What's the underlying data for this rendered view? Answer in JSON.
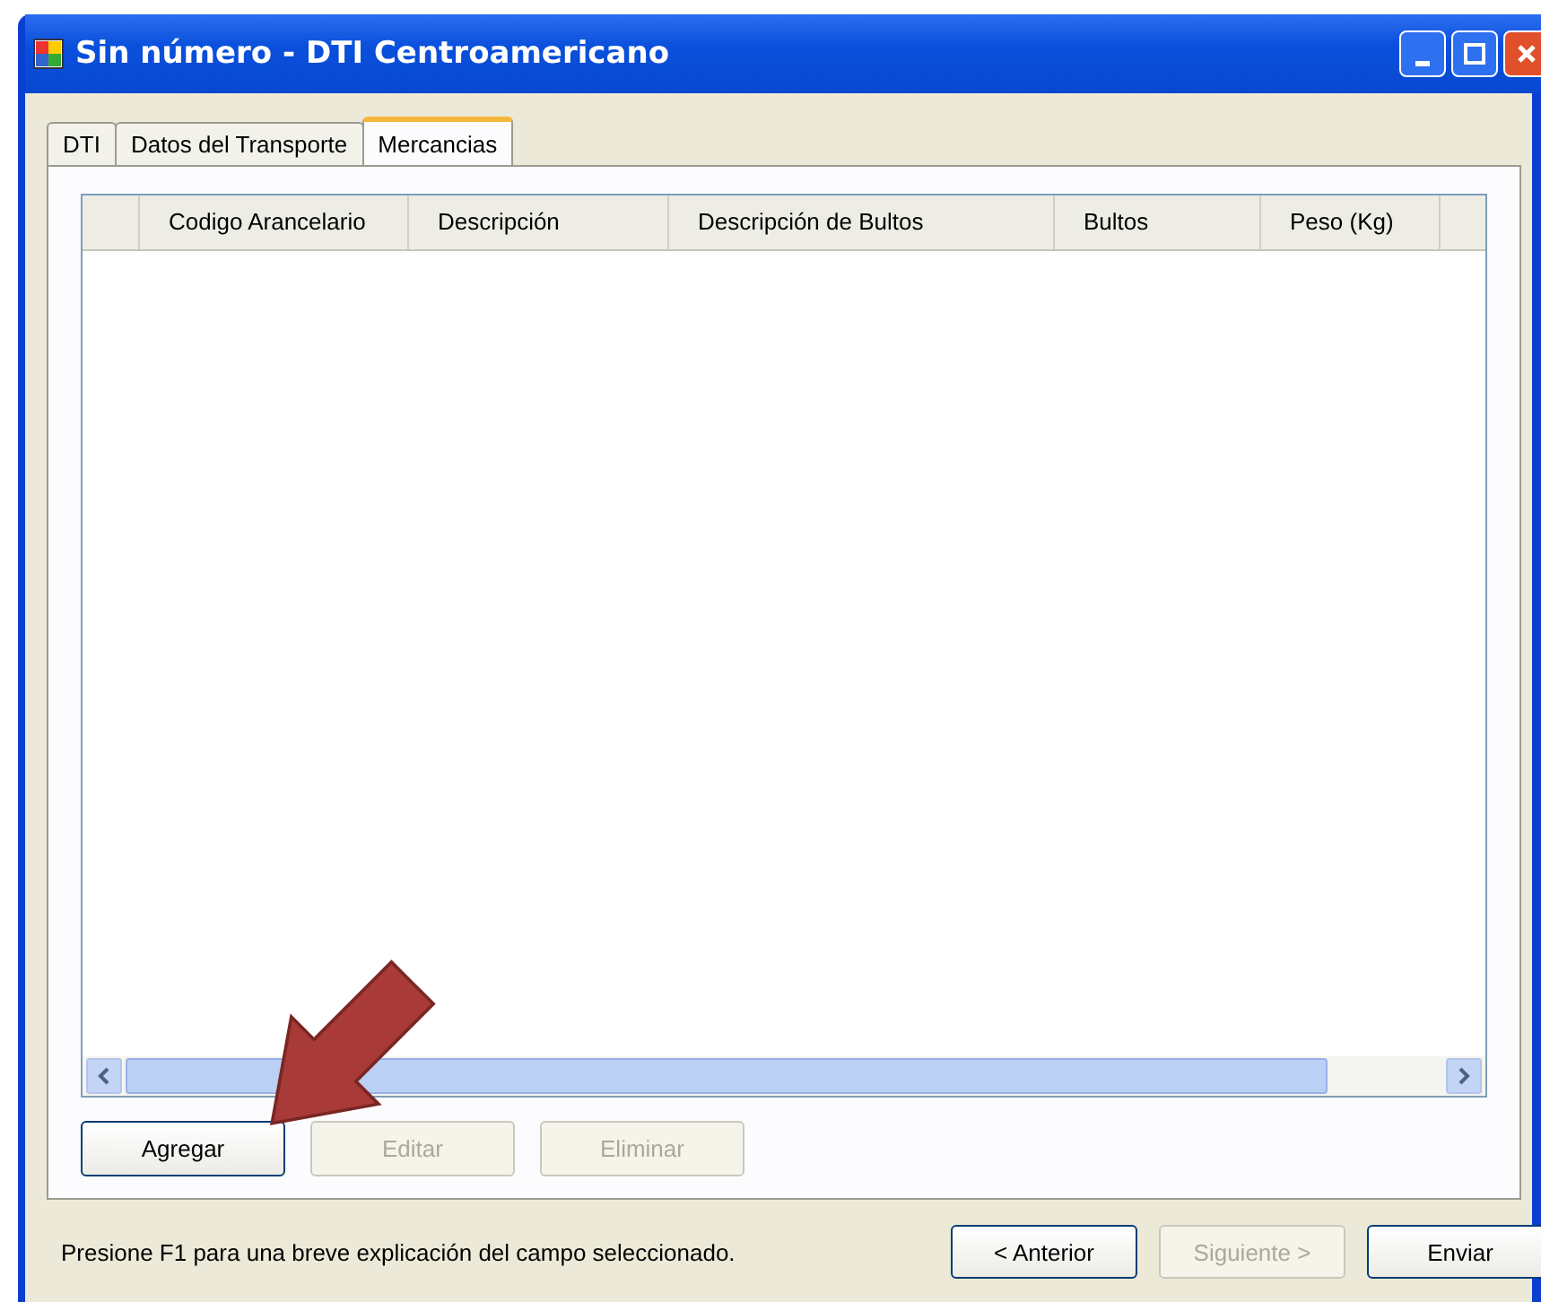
{
  "window": {
    "title": "Sin número - DTI Centroamericano"
  },
  "tabs": [
    {
      "label": "DTI",
      "selected": false
    },
    {
      "label": "Datos del Transporte",
      "selected": false
    },
    {
      "label": "Mercancias",
      "selected": true
    }
  ],
  "table": {
    "columns": [
      "Codigo Arancelario",
      "Descripción",
      "Descripción de Bultos",
      "Bultos",
      "Peso (Kg)"
    ]
  },
  "grid_buttons": [
    {
      "label": "Agregar",
      "disabled": false
    },
    {
      "label": "Editar",
      "disabled": true
    },
    {
      "label": "Eliminar",
      "disabled": true
    }
  ],
  "status_text": "Presione F1 para una breve explicación del campo seleccionado.",
  "nav_buttons": [
    {
      "label": "< Anterior",
      "disabled": false
    },
    {
      "label": "Siguiente >",
      "disabled": true
    },
    {
      "label": "Enviar",
      "disabled": false
    }
  ]
}
